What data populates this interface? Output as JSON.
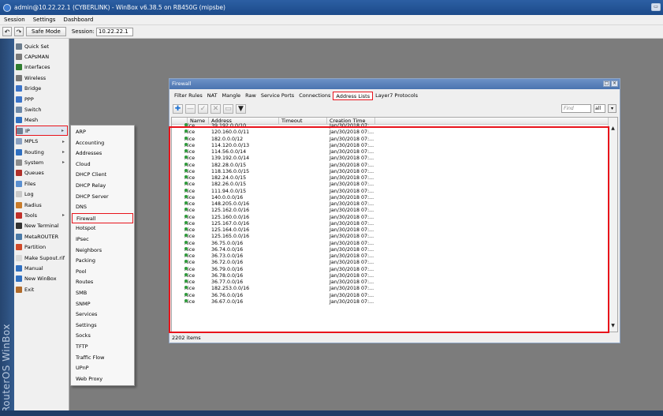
{
  "window": {
    "title": "admin@10.22.22.1 (CYBERLINK) - WinBox v6.38.5 on RB450G (mipsbe)",
    "restore_icon": "restore-icon"
  },
  "menubar": {
    "items": [
      "Session",
      "Settings",
      "Dashboard"
    ]
  },
  "toolbar": {
    "undo_icon": "undo-icon",
    "redo_icon": "redo-icon",
    "safe_mode": "Safe Mode",
    "session_label": "Session:",
    "session_value": "10.22.22.1"
  },
  "brand": {
    "vertical_text": "RouterOS WinBox"
  },
  "sidebar": {
    "items": [
      {
        "label": "Quick Set",
        "icon": "quick-set-icon",
        "color": "#6a7b8c"
      },
      {
        "label": "CAPsMAN",
        "icon": "capsman-icon",
        "color": "#7a7a7a"
      },
      {
        "label": "Interfaces",
        "icon": "interfaces-icon",
        "color": "#2f7d2f"
      },
      {
        "label": "Wireless",
        "icon": "wireless-icon",
        "color": "#777777"
      },
      {
        "label": "Bridge",
        "icon": "bridge-icon",
        "color": "#3a73c8"
      },
      {
        "label": "PPP",
        "icon": "ppp-icon",
        "color": "#3a73c8"
      },
      {
        "label": "Switch",
        "icon": "switch-icon",
        "color": "#6d89a8"
      },
      {
        "label": "Mesh",
        "icon": "mesh-icon",
        "color": "#2f6fc0"
      },
      {
        "label": "IP",
        "icon": "ip-icon",
        "color": "#6d7f93",
        "arrow": true
      },
      {
        "label": "MPLS",
        "icon": "mpls-icon",
        "color": "#8aa0c0",
        "arrow": true
      },
      {
        "label": "Routing",
        "icon": "routing-icon",
        "color": "#2f6fc0",
        "arrow": true
      },
      {
        "label": "System",
        "icon": "system-icon",
        "color": "#8b8b8b",
        "arrow": true
      },
      {
        "label": "Queues",
        "icon": "queues-icon",
        "color": "#b0302a"
      },
      {
        "label": "Files",
        "icon": "files-icon",
        "color": "#5a8fd0"
      },
      {
        "label": "Log",
        "icon": "log-icon",
        "color": "#c8c8c8"
      },
      {
        "label": "Radius",
        "icon": "radius-icon",
        "color": "#c87b2a"
      },
      {
        "label": "Tools",
        "icon": "tools-icon",
        "color": "#c0302a",
        "arrow": true
      },
      {
        "label": "New Terminal",
        "icon": "terminal-icon",
        "color": "#333333"
      },
      {
        "label": "MetaROUTER",
        "icon": "metarouter-icon",
        "color": "#4a7aa8"
      },
      {
        "label": "Partition",
        "icon": "partition-icon",
        "color": "#d04a2a"
      },
      {
        "label": "Make Supout.rif",
        "icon": "supout-icon",
        "color": "#d8d8d8"
      },
      {
        "label": "Manual",
        "icon": "manual-icon",
        "color": "#2f6fc0"
      },
      {
        "label": "New WinBox",
        "icon": "winbox-icon",
        "color": "#2f6fc0"
      },
      {
        "label": "Exit",
        "icon": "exit-icon",
        "color": "#b06a2a"
      }
    ]
  },
  "submenu": {
    "items": [
      "ARP",
      "Accounting",
      "Addresses",
      "Cloud",
      "DHCP Client",
      "DHCP Relay",
      "DHCP Server",
      "DNS",
      "Firewall",
      "Hotspot",
      "IPsec",
      "Neighbors",
      "Packing",
      "Pool",
      "Routes",
      "SMB",
      "SNMP",
      "Services",
      "Settings",
      "Socks",
      "TFTP",
      "Traffic Flow",
      "UPnP",
      "Web Proxy"
    ]
  },
  "firewall": {
    "title": "Firewall",
    "tabs": [
      "Filter Rules",
      "NAT",
      "Mangle",
      "Raw",
      "Service Ports",
      "Connections",
      "Address Lists",
      "Layer7 Protocols"
    ],
    "find_placeholder": "Find",
    "find_filter": "all",
    "columns": [
      "Name",
      "Address",
      "Timeout",
      "Creation Time"
    ],
    "rows": [
      {
        "name": "nice",
        "address": "39.192.0.0/10",
        "timeout": "",
        "created": "Jan/30/2018 07:..."
      },
      {
        "name": "nice",
        "address": "120.160.0.0/11",
        "timeout": "",
        "created": "Jan/30/2018 07:..."
      },
      {
        "name": "nice",
        "address": "182.0.0.0/12",
        "timeout": "",
        "created": "Jan/30/2018 07:..."
      },
      {
        "name": "nice",
        "address": "114.120.0.0/13",
        "timeout": "",
        "created": "Jan/30/2018 07:..."
      },
      {
        "name": "nice",
        "address": "114.56.0.0/14",
        "timeout": "",
        "created": "Jan/30/2018 07:..."
      },
      {
        "name": "nice",
        "address": "139.192.0.0/14",
        "timeout": "",
        "created": "Jan/30/2018 07:..."
      },
      {
        "name": "nice",
        "address": "182.28.0.0/15",
        "timeout": "",
        "created": "Jan/30/2018 07:..."
      },
      {
        "name": "nice",
        "address": "118.136.0.0/15",
        "timeout": "",
        "created": "Jan/30/2018 07:..."
      },
      {
        "name": "nice",
        "address": "182.24.0.0/15",
        "timeout": "",
        "created": "Jan/30/2018 07:..."
      },
      {
        "name": "nice",
        "address": "182.26.0.0/15",
        "timeout": "",
        "created": "Jan/30/2018 07:..."
      },
      {
        "name": "nice",
        "address": "111.94.0.0/15",
        "timeout": "",
        "created": "Jan/30/2018 07:..."
      },
      {
        "name": "nice",
        "address": "140.0.0.0/16",
        "timeout": "",
        "created": "Jan/30/2018 07:..."
      },
      {
        "name": "nice",
        "address": "148.205.0.0/16",
        "timeout": "",
        "created": "Jan/30/2018 07:..."
      },
      {
        "name": "nice",
        "address": "125.162.0.0/16",
        "timeout": "",
        "created": "Jan/30/2018 07:..."
      },
      {
        "name": "nice",
        "address": "125.160.0.0/16",
        "timeout": "",
        "created": "Jan/30/2018 07:..."
      },
      {
        "name": "nice",
        "address": "125.167.0.0/16",
        "timeout": "",
        "created": "Jan/30/2018 07:..."
      },
      {
        "name": "nice",
        "address": "125.164.0.0/16",
        "timeout": "",
        "created": "Jan/30/2018 07:..."
      },
      {
        "name": "nice",
        "address": "125.165.0.0/16",
        "timeout": "",
        "created": "Jan/30/2018 07:..."
      },
      {
        "name": "nice",
        "address": "36.75.0.0/16",
        "timeout": "",
        "created": "Jan/30/2018 07:..."
      },
      {
        "name": "nice",
        "address": "36.74.0.0/16",
        "timeout": "",
        "created": "Jan/30/2018 07:..."
      },
      {
        "name": "nice",
        "address": "36.73.0.0/16",
        "timeout": "",
        "created": "Jan/30/2018 07:..."
      },
      {
        "name": "nice",
        "address": "36.72.0.0/16",
        "timeout": "",
        "created": "Jan/30/2018 07:..."
      },
      {
        "name": "nice",
        "address": "36.79.0.0/16",
        "timeout": "",
        "created": "Jan/30/2018 07:..."
      },
      {
        "name": "nice",
        "address": "36.78.0.0/16",
        "timeout": "",
        "created": "Jan/30/2018 07:..."
      },
      {
        "name": "nice",
        "address": "36.77.0.0/16",
        "timeout": "",
        "created": "Jan/30/2018 07:..."
      },
      {
        "name": "nice",
        "address": "182.253.0.0/16",
        "timeout": "",
        "created": "Jan/30/2018 07:..."
      },
      {
        "name": "nice",
        "address": "36.76.0.0/16",
        "timeout": "",
        "created": "Jan/30/2018 07:..."
      },
      {
        "name": "nice",
        "address": "36.67.0.0/16",
        "timeout": "",
        "created": "Jan/30/2018 07:..."
      }
    ],
    "status": "2202 items"
  }
}
